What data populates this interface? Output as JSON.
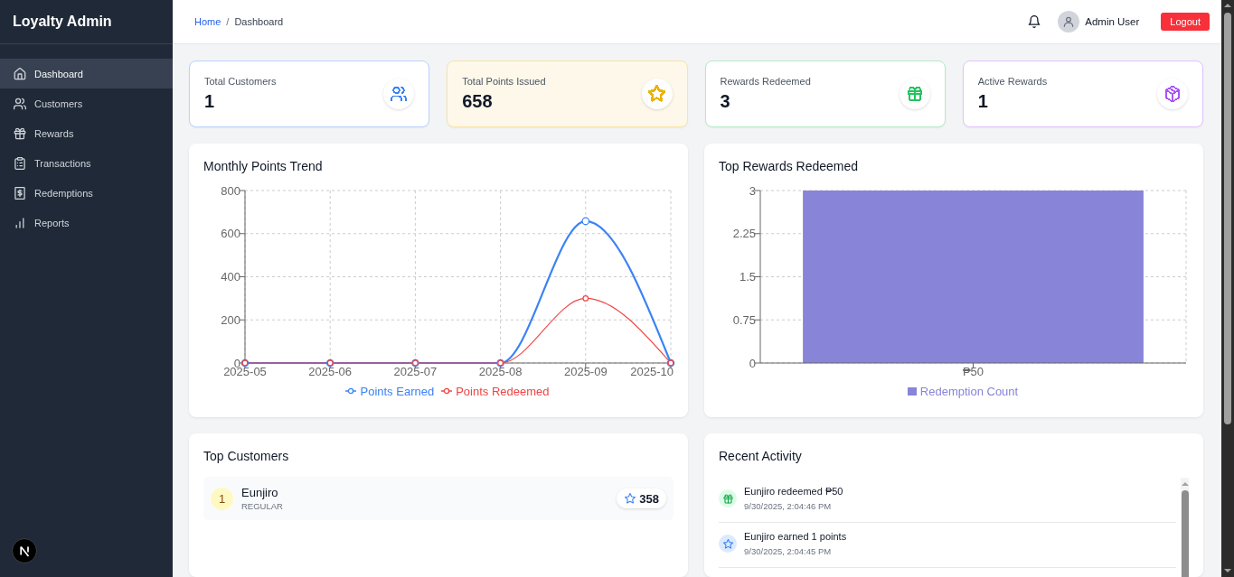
{
  "sidebar": {
    "title": "Loyalty Admin",
    "items": [
      {
        "label": "Dashboard",
        "selected": true
      },
      {
        "label": "Customers",
        "selected": false
      },
      {
        "label": "Rewards",
        "selected": false
      },
      {
        "label": "Transactions",
        "selected": false
      },
      {
        "label": "Redemptions",
        "selected": false
      },
      {
        "label": "Reports",
        "selected": false
      }
    ]
  },
  "header": {
    "breadcrumb": [
      {
        "label": "Home",
        "kind": "link"
      },
      {
        "label": "Dashboard",
        "kind": "current"
      }
    ],
    "separator": "/",
    "user_name": "Admin User",
    "logout_button": "Logout"
  },
  "stats": [
    {
      "label": "Total Customers",
      "value": "1",
      "color": "#3b82f6",
      "highlighted": false
    },
    {
      "label": "Total Points Issued",
      "value": "658",
      "color": "#eab308",
      "highlighted": true
    },
    {
      "label": "Rewards Redeemed",
      "value": "3",
      "color": "#22c55e",
      "highlighted": false
    },
    {
      "label": "Active Rewards",
      "value": "1",
      "color": "#a855f7",
      "highlighted": false
    }
  ],
  "points_trend": {
    "title": "Monthly Points Trend",
    "chart_data": {
      "type": "line",
      "categories": [
        "2025-05",
        "2025-06",
        "2025-07",
        "2025-08",
        "2025-09",
        "2025-10"
      ],
      "series": [
        {
          "name": "Points Earned",
          "color": "#3b82f6",
          "marker": "circle",
          "values": [
            0,
            0,
            0,
            0,
            658,
            0
          ]
        },
        {
          "name": "Points Redeemed",
          "color": "#ef4444",
          "marker": "circle",
          "values": [
            0,
            0,
            0,
            0,
            300,
            0
          ]
        }
      ],
      "ylim": [
        0,
        800
      ],
      "yticks": [
        0,
        200,
        400,
        600,
        800
      ],
      "grid": true,
      "legend": "bottom"
    }
  },
  "top_rewards": {
    "title": "Top Rewards Redeemed",
    "chart_data": {
      "type": "bar",
      "categories": [
        "₱50"
      ],
      "series": [
        {
          "name": "Redemption Count",
          "color": "#8884d8",
          "values": [
            3
          ]
        }
      ],
      "ylim": [
        0,
        3
      ],
      "yticks": [
        0,
        0.75,
        1.5,
        2.25,
        3
      ],
      "grid": true,
      "legend": "bottom"
    }
  },
  "top_customers": {
    "title": "Top Customers",
    "rows": [
      {
        "rank": "1",
        "name": "Eunjiro",
        "tier": "REGULAR",
        "points": "358"
      }
    ]
  },
  "recent_activity": {
    "title": "Recent Activity",
    "items": [
      {
        "kind": "redemption",
        "text": "Eunjiro redeemed ₱50",
        "time": "9/30/2025, 2:04:46 PM"
      },
      {
        "kind": "earning",
        "text": "Eunjiro earned 1 points",
        "time": "9/30/2025, 2:04:45 PM"
      }
    ]
  }
}
